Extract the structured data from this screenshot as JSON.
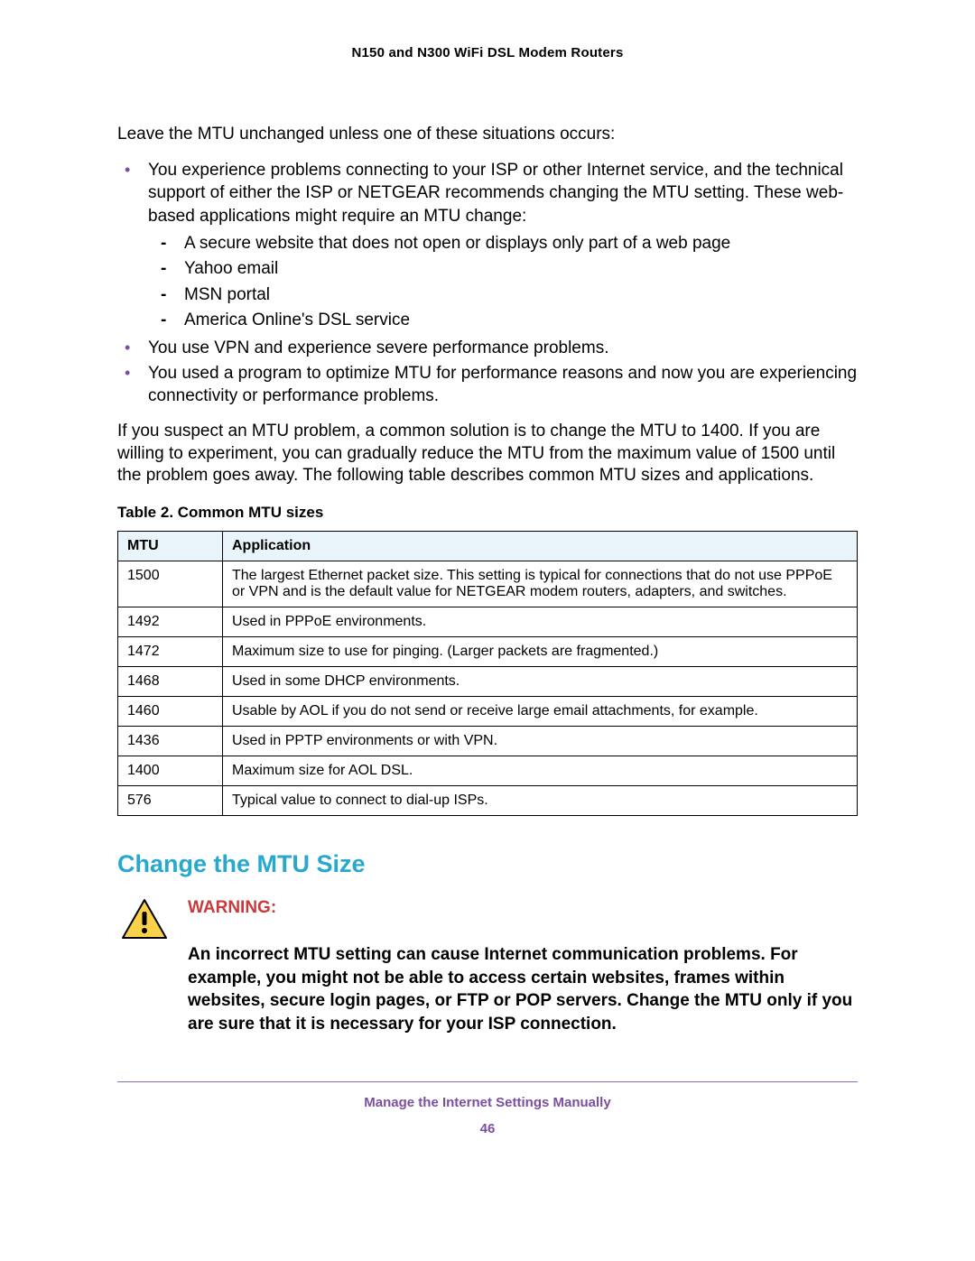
{
  "header": {
    "title": "N150 and N300 WiFi DSL Modem Routers"
  },
  "intro_para": "Leave the MTU unchanged unless one of these situations occurs:",
  "bullets": [
    {
      "text": "You experience problems connecting to your ISP or other Internet service, and the technical support of either the ISP or NETGEAR recommends changing the MTU setting. These web-based applications might require an MTU change:",
      "sub": [
        "A secure website that does not open or displays only part of a web page",
        "Yahoo email",
        "MSN portal",
        "America Online's DSL service"
      ]
    },
    {
      "text": "You use VPN and experience severe performance problems."
    },
    {
      "text": "You used a program to optimize MTU for performance reasons and now you are experiencing connectivity or performance problems."
    }
  ],
  "para2": "If you suspect an MTU problem, a common solution is to change the MTU to 1400. If you are willing to experiment, you can gradually reduce the MTU from the maximum value of 1500 until the problem goes away. The following table describes common MTU sizes and applications.",
  "table": {
    "caption": "Table 2.  Common MTU sizes",
    "headers": {
      "c1": "MTU",
      "c2": "Application"
    },
    "rows": [
      {
        "mtu": "1500",
        "app": "The largest Ethernet packet size. This setting is typical for connections that do not use PPPoE or VPN and is the default value for NETGEAR modem routers, adapters, and switches."
      },
      {
        "mtu": "1492",
        "app": "Used in PPPoE environments."
      },
      {
        "mtu": "1472",
        "app": "Maximum size to use for pinging. (Larger packets are fragmented.)"
      },
      {
        "mtu": "1468",
        "app": "Used in some DHCP environments."
      },
      {
        "mtu": "1460",
        "app": "Usable by AOL if you do not send or receive large email attachments, for example."
      },
      {
        "mtu": "1436",
        "app": "Used in PPTP environments or with VPN."
      },
      {
        "mtu": "1400",
        "app": "Maximum size for AOL DSL."
      },
      {
        "mtu": "576",
        "app": "Typical value to connect to dial-up ISPs."
      }
    ]
  },
  "section_heading": "Change the MTU Size",
  "warning": {
    "label": "WARNING:",
    "text": "An incorrect MTU setting can cause Internet communication problems. For example, you might not be able to access certain websites, frames within websites, secure login pages, or FTP or POP servers. Change the MTU only if you are sure that it is necessary for your ISP connection."
  },
  "footer": {
    "title": "Manage the Internet Settings Manually",
    "page": "46"
  }
}
